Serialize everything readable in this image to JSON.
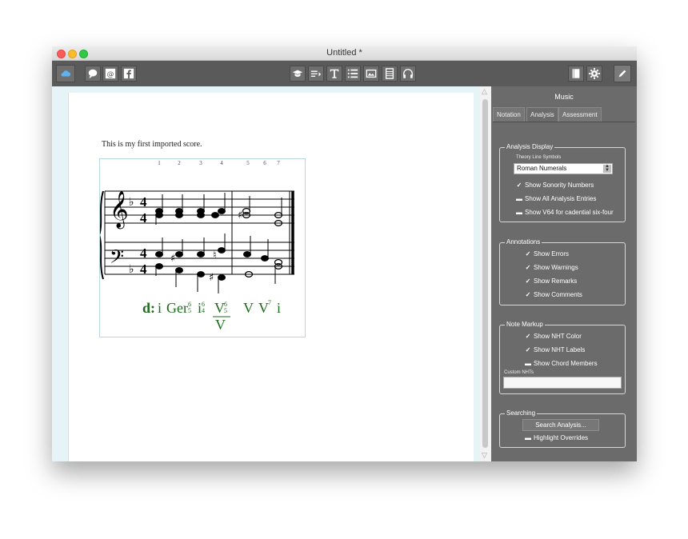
{
  "window": {
    "title": "Untitled *"
  },
  "toolbar": {
    "left": [
      "cloud-icon",
      "chat-icon",
      "at-icon",
      "facebook-icon"
    ],
    "center": [
      "graduation-cap-icon",
      "list-arrow-icon",
      "text-icon",
      "list-icon",
      "image-icon",
      "film-icon",
      "headphones-icon"
    ],
    "right": [
      "book-icon",
      "gear-icon",
      "pencil-icon"
    ]
  },
  "document": {
    "caption": "This is my first imported score.",
    "measure_numbers": [
      "1",
      "2",
      "3",
      "4",
      "5",
      "6",
      "7"
    ],
    "analysis": {
      "key": "d:",
      "chord_i": "i",
      "ger": "Ger",
      "ger_top": "6",
      "ger_bot": "5",
      "i64": "i",
      "i64_top": "6",
      "i64_bot": "4",
      "v_of_v": "V",
      "v_of_v_top": "6",
      "v_of_v_bot": "5",
      "slash_v": "V",
      "v": "V",
      "v7": "V",
      "v7_sup": "7",
      "final_i": "i"
    }
  },
  "panel": {
    "title": "Music",
    "tabs": [
      "Notation",
      "Analysis",
      "Assessment"
    ],
    "active_tab": "Analysis",
    "analysis_display": {
      "legend": "Analysis Display",
      "theory_line_label": "Theory Line Symbols",
      "theory_line_value": "Roman Numerals",
      "options": [
        {
          "label": "Show Sonority Numbers",
          "checked": true
        },
        {
          "label": "Show All Analysis Entries",
          "checked": false
        },
        {
          "label": "Show V64 for cadential six-four",
          "checked": false
        }
      ]
    },
    "annotations": {
      "legend": "Annotations",
      "options": [
        {
          "label": "Show Errors",
          "checked": true
        },
        {
          "label": "Show Warnings",
          "checked": true
        },
        {
          "label": "Show Remarks",
          "checked": true
        },
        {
          "label": "Show Comments",
          "checked": true
        }
      ]
    },
    "note_markup": {
      "legend": "Note Markup",
      "options": [
        {
          "label": "Show NHT Color",
          "checked": true
        },
        {
          "label": "Show NHT Labels",
          "checked": true
        },
        {
          "label": "Show Chord Members",
          "checked": false
        }
      ],
      "custom_label": "Custom NHTs",
      "custom_value": ""
    },
    "searching": {
      "legend": "Searching",
      "button": "Search Analysis...",
      "option": {
        "label": "Highlight Overrides",
        "checked": false
      }
    }
  },
  "colors": {
    "toolbar": "#5a5a5a",
    "panel": "#6b6b6b",
    "analysis_text": "#1c6b1c",
    "doc_bg": "#e6f4f7"
  }
}
